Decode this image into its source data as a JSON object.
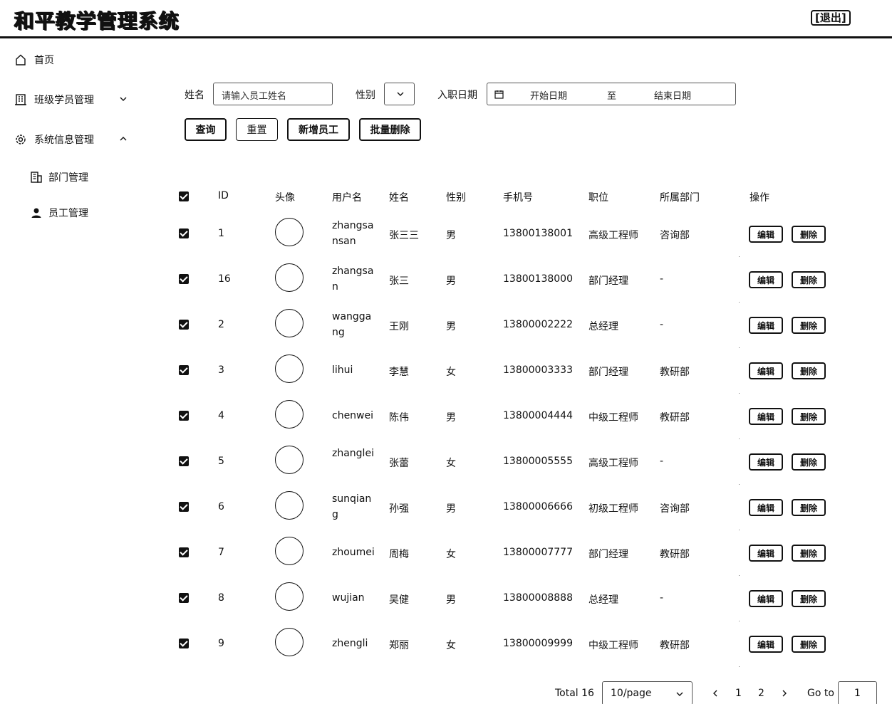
{
  "header": {
    "title": "和平教学管理系统",
    "logout_label": "[退出]"
  },
  "sidebar": {
    "home": "首页",
    "class_mgmt": "班级学员管理",
    "system_mgmt": "系统信息管理",
    "dept_mgmt": "部门管理",
    "emp_mgmt": "员工管理"
  },
  "filter": {
    "name_label": "姓名",
    "name_placeholder": "请输入员工姓名",
    "gender_label": "性别",
    "hire_label": "入职日期",
    "start_placeholder": "开始日期",
    "date_sep": "至",
    "end_placeholder": "结束日期"
  },
  "actions": {
    "query": "查询",
    "reset": "重置",
    "add": "新增员工",
    "batch_delete": "批量删除"
  },
  "table": {
    "headers": [
      "ID",
      "头像",
      "用户名",
      "姓名",
      "性别",
      "手机号",
      "职位",
      "所属部门",
      "操作"
    ],
    "edit_label": "编辑",
    "delete_label": "删除",
    "rows": [
      {
        "id": "1",
        "username": "zhangsansan",
        "name": "张三三",
        "gender": "男",
        "phone": "13800138001",
        "position": "高级工程师",
        "dept": "咨询部"
      },
      {
        "id": "16",
        "username": "zhangsan",
        "name": "张三",
        "gender": "男",
        "phone": "13800138000",
        "position": "部门经理",
        "dept": "-"
      },
      {
        "id": "2",
        "username": "wanggang",
        "name": "王刚",
        "gender": "男",
        "phone": "13800002222",
        "position": "总经理",
        "dept": "-"
      },
      {
        "id": "3",
        "username": "lihui",
        "name": "李慧",
        "gender": "女",
        "phone": "13800003333",
        "position": "部门经理",
        "dept": "教研部"
      },
      {
        "id": "4",
        "username": "chenwei",
        "name": "陈伟",
        "gender": "男",
        "phone": "13800004444",
        "position": "中级工程师",
        "dept": "教研部"
      },
      {
        "id": "5",
        "username": "zhanglei",
        "name": "张蕾",
        "gender": "女",
        "phone": "13800005555",
        "position": "高级工程师",
        "dept": "-"
      },
      {
        "id": "6",
        "username": "sunqiang",
        "name": "孙强",
        "gender": "男",
        "phone": "13800006666",
        "position": "初级工程师",
        "dept": "咨询部"
      },
      {
        "id": "7",
        "username": "zhoumei",
        "name": "周梅",
        "gender": "女",
        "phone": "13800007777",
        "position": "部门经理",
        "dept": "教研部"
      },
      {
        "id": "8",
        "username": "wujian",
        "name": "吴健",
        "gender": "男",
        "phone": "13800008888",
        "position": "总经理",
        "dept": "-"
      },
      {
        "id": "9",
        "username": "zhengli",
        "name": "郑丽",
        "gender": "女",
        "phone": "13800009999",
        "position": "中级工程师",
        "dept": "教研部"
      }
    ]
  },
  "pagination": {
    "total": "Total 16",
    "page_size": "10/page",
    "pages": [
      "1",
      "2"
    ],
    "goto_label": "Go to",
    "goto_value": "1"
  }
}
